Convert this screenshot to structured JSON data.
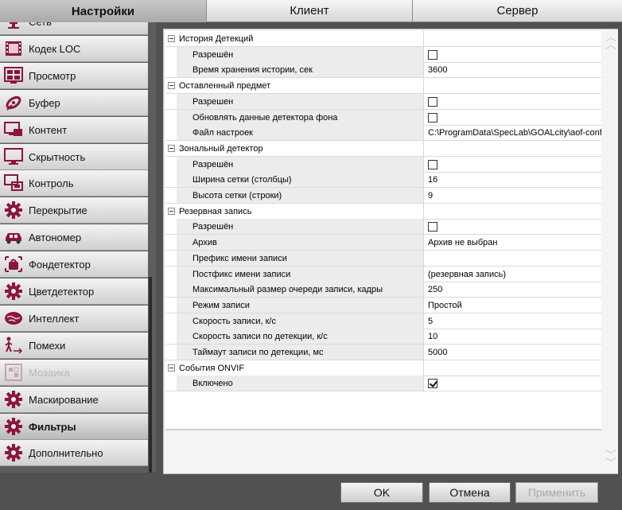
{
  "tabs": [
    "Настройки",
    "Клиент",
    "Сервер"
  ],
  "sidebar": {
    "items": [
      {
        "label": "Сеть",
        "icon": "network-icon"
      },
      {
        "label": "Кодек LOC",
        "icon": "film-icon"
      },
      {
        "label": "Просмотр",
        "icon": "monitor-grid-icon"
      },
      {
        "label": "Буфер",
        "icon": "satellite-icon"
      },
      {
        "label": "Контент",
        "icon": "content-icon"
      },
      {
        "label": "Скрытность",
        "icon": "screen-icon"
      },
      {
        "label": "Контроль",
        "icon": "control-icon"
      },
      {
        "label": "Перекрытие",
        "icon": "gear-icon"
      },
      {
        "label": "Автономер",
        "icon": "car-icon"
      },
      {
        "label": "Фондетектор",
        "icon": "bag-icon"
      },
      {
        "label": "Цветдетектор",
        "icon": "gear-icon"
      },
      {
        "label": "Интеллект",
        "icon": "brain-icon"
      },
      {
        "label": "Помехи",
        "icon": "walker-icon"
      },
      {
        "label": "Мозаика",
        "icon": "mosaic-icon"
      },
      {
        "label": "Маскирование",
        "icon": "gear-icon"
      },
      {
        "label": "Фильтры",
        "icon": "gear-icon"
      },
      {
        "label": "Дополнительно",
        "icon": "gear-icon"
      }
    ],
    "selected": "Фильтры",
    "disabled": [
      "Мозаика"
    ]
  },
  "properties": [
    {
      "type": "group",
      "name": "История Детекций"
    },
    {
      "type": "prop",
      "name": "Разрешён",
      "checkbox": false
    },
    {
      "type": "prop",
      "name": "Время хранения истории, сек",
      "value": "3600"
    },
    {
      "type": "group",
      "name": "Оставленный предмет"
    },
    {
      "type": "prop",
      "name": "Разрешен",
      "checkbox": false
    },
    {
      "type": "prop",
      "name": "Обновлять данные детектора фона",
      "checkbox": false
    },
    {
      "type": "prop",
      "name": "Файл настроек",
      "value": "C:\\ProgramData\\SpecLab\\GOALcity\\aof-config."
    },
    {
      "type": "group",
      "name": "Зональный детектор"
    },
    {
      "type": "prop",
      "name": "Разрешён",
      "checkbox": false
    },
    {
      "type": "prop",
      "name": "Ширина сетки (столбцы)",
      "value": "16"
    },
    {
      "type": "prop",
      "name": "Высота сетки (строки)",
      "value": "9"
    },
    {
      "type": "group",
      "name": "Резервная запись"
    },
    {
      "type": "prop",
      "name": "Разрешён",
      "checkbox": false
    },
    {
      "type": "prop",
      "name": "Архив",
      "value": "Архив не выбран"
    },
    {
      "type": "prop",
      "name": "Префикс имени записи",
      "value": ""
    },
    {
      "type": "prop",
      "name": "Постфикс имени записи",
      "value": "(резервная запись)"
    },
    {
      "type": "prop",
      "name": "Максимальный размер очереди записи, кадры",
      "value": "250"
    },
    {
      "type": "prop",
      "name": "Режим записи",
      "value": "Простой"
    },
    {
      "type": "prop",
      "name": "Скорость записи, к/с",
      "value": "5"
    },
    {
      "type": "prop",
      "name": "Скорость записи по детекции, к/с",
      "value": "10"
    },
    {
      "type": "prop",
      "name": "Таймаут записи по детекции, мс",
      "value": "5000"
    },
    {
      "type": "group",
      "name": "События ONVIF"
    },
    {
      "type": "prop",
      "name": "Включено",
      "checkbox": true
    }
  ],
  "buttons": {
    "ok": "OK",
    "cancel": "Отмена",
    "apply": "Применить"
  },
  "colors": {
    "accent": "#8b1538",
    "background": "#515151"
  }
}
